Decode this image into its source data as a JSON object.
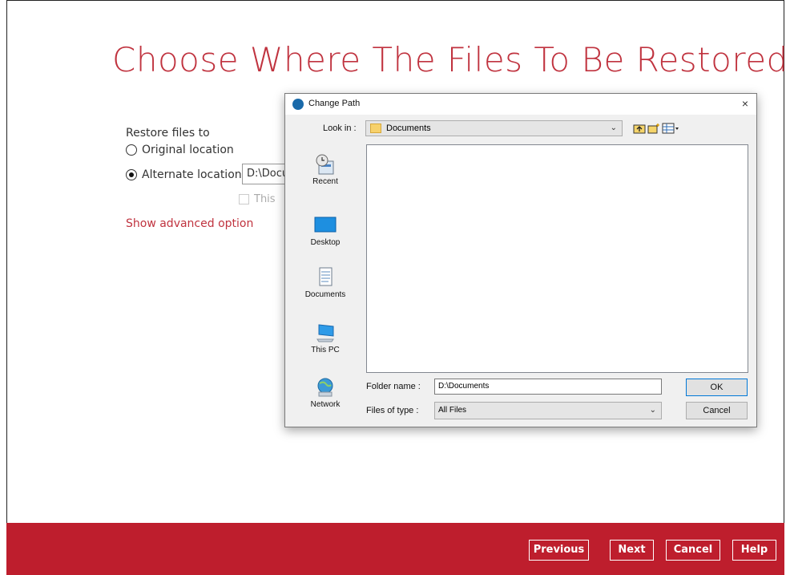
{
  "page": {
    "title": "Choose Where The Files To Be Restored",
    "restore_label": "Restore files to",
    "original_location": "Original location",
    "alternate_location": "Alternate location",
    "alternate_path": "D:\\Documents",
    "checkbox_label": "This",
    "advanced_link": "Show advanced option"
  },
  "footer": {
    "previous": "Previous",
    "next": "Next",
    "cancel": "Cancel",
    "help": "Help",
    "bar_color": "#be1e2d"
  },
  "dialog": {
    "title": "Change Path",
    "close": "×",
    "look_in_label": "Look in :",
    "look_in_value": "Documents",
    "toolbar_icons": [
      "up-folder-icon",
      "new-folder-icon",
      "view-menu-icon"
    ],
    "places": [
      "Recent",
      "Desktop",
      "Documents",
      "This PC",
      "Network"
    ],
    "folder_name_label": "Folder name :",
    "folder_name_value": "D:\\Documents",
    "files_of_type_label": "Files of type :",
    "files_of_type_value": "All Files",
    "ok": "OK",
    "cancel": "Cancel"
  },
  "colors": {
    "accent": "#c0333f"
  }
}
